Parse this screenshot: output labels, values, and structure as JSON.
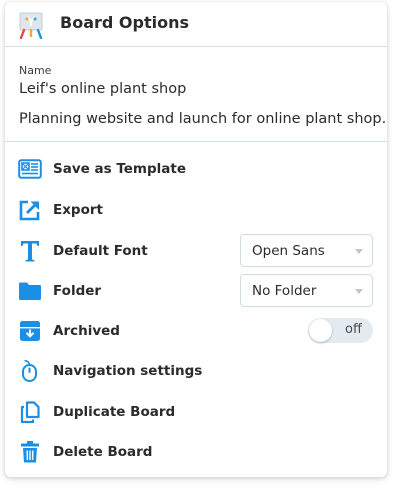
{
  "header": {
    "title": "Board Options",
    "icon": "easel-icon"
  },
  "board": {
    "name_label": "Name",
    "name": "Leif's online plant shop",
    "description": "Planning website and launch for online plant shop."
  },
  "menu": [
    {
      "id": "save-template",
      "label": "Save as Template",
      "icon": "template-icon"
    },
    {
      "id": "export",
      "label": "Export",
      "icon": "export-icon"
    },
    {
      "id": "default-font",
      "label": "Default Font",
      "icon": "font-icon",
      "control": "select",
      "value": "Open Sans"
    },
    {
      "id": "folder",
      "label": "Folder",
      "icon": "folder-icon",
      "control": "select",
      "value": "No Folder"
    },
    {
      "id": "archived",
      "label": "Archived",
      "icon": "archive-icon",
      "control": "toggle",
      "value": "off"
    },
    {
      "id": "navigation",
      "label": "Navigation settings",
      "icon": "mouse-icon"
    },
    {
      "id": "duplicate",
      "label": "Duplicate Board",
      "icon": "duplicate-icon"
    },
    {
      "id": "delete",
      "label": "Delete Board",
      "icon": "trash-icon"
    }
  ],
  "colors": {
    "accent": "#1b8fe6",
    "text": "#2b2b2b",
    "divider": "#d4e2ea"
  }
}
